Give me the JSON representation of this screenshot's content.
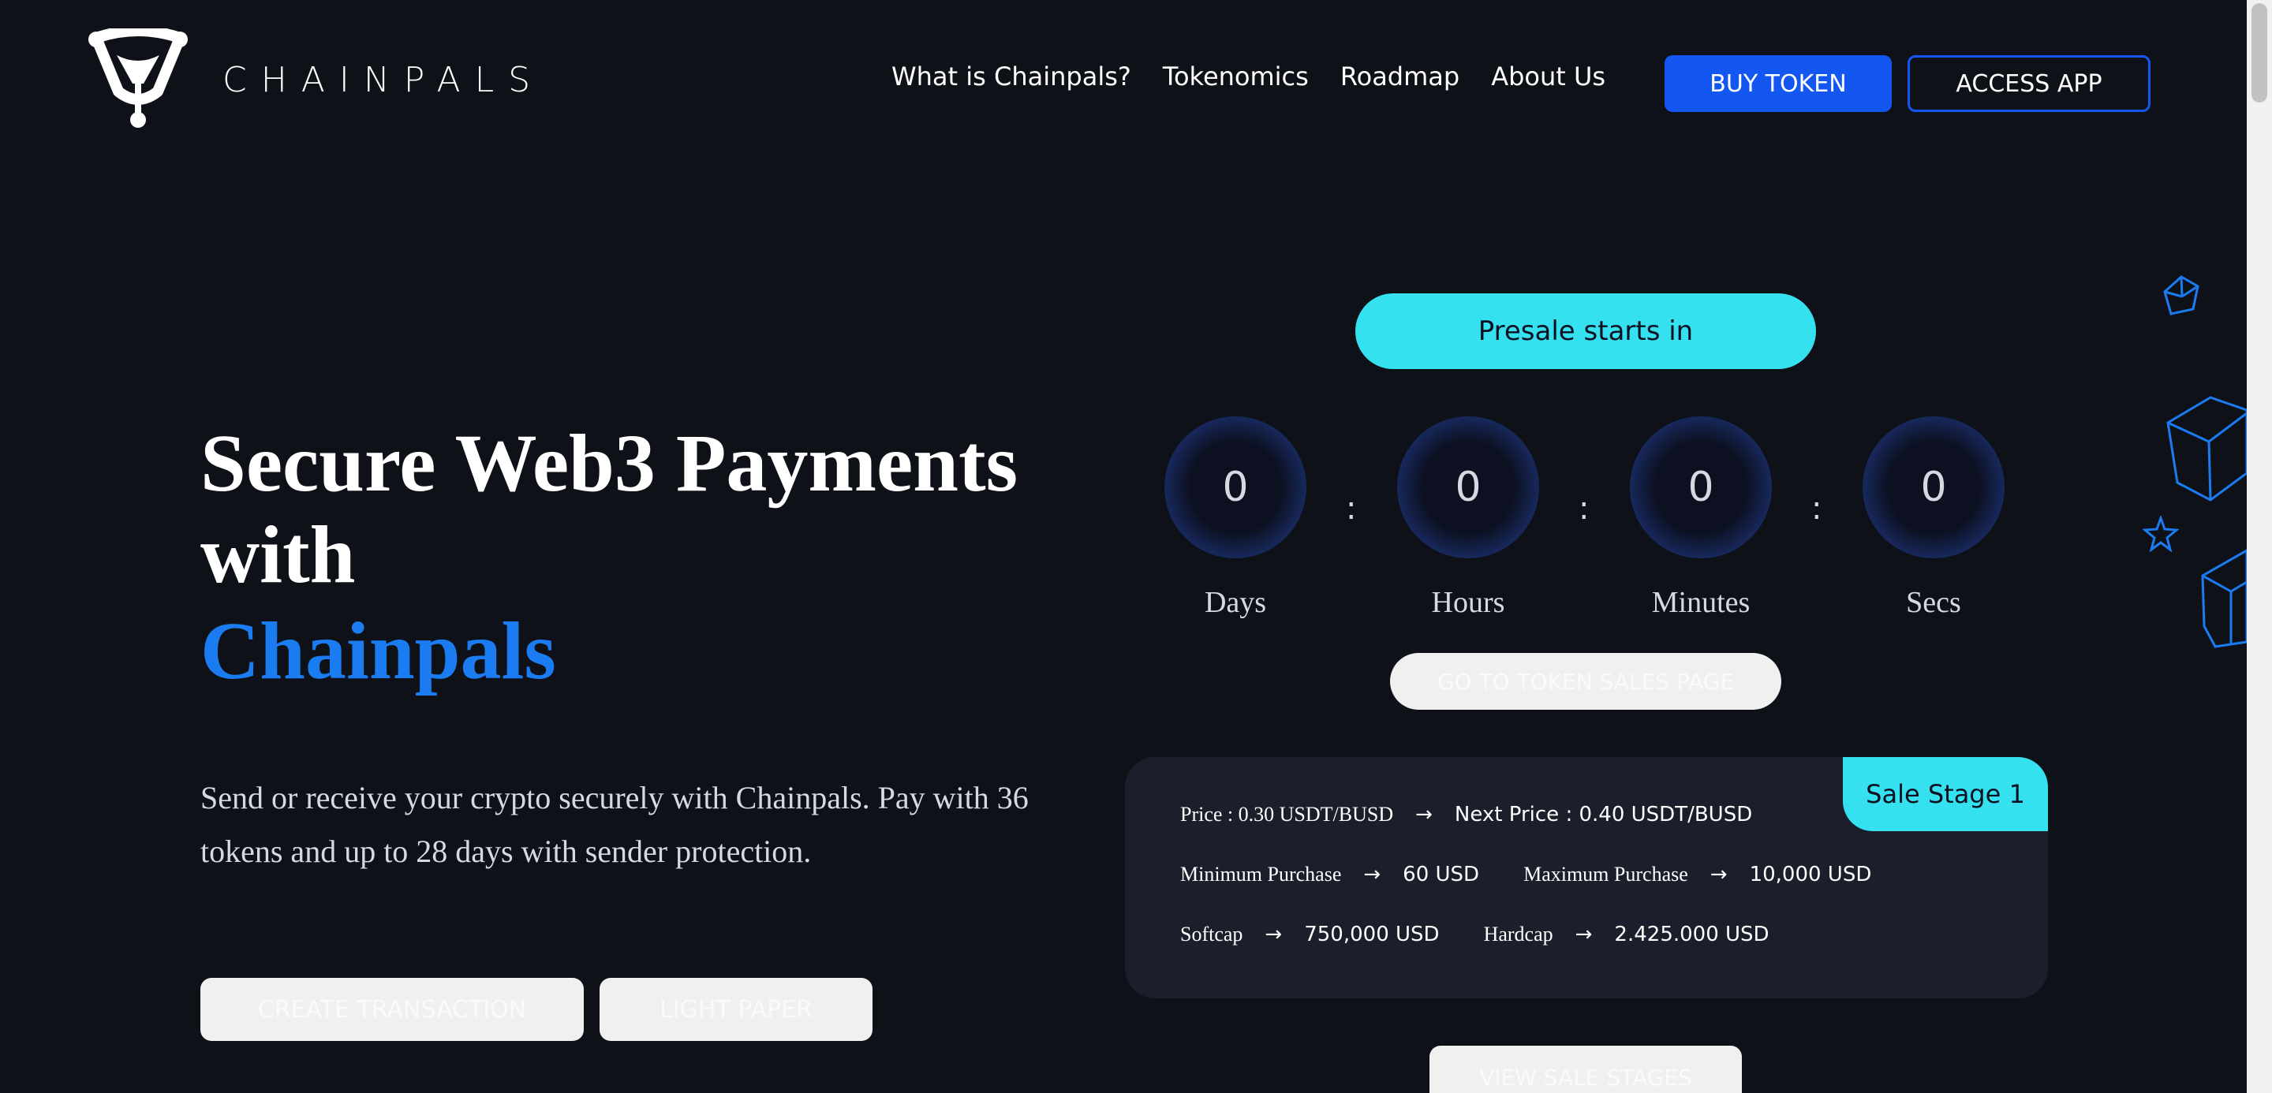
{
  "header": {
    "brand": "CHAINPALS",
    "nav": [
      "What is Chainpals?",
      "Tokenomics",
      "Roadmap",
      "About Us"
    ],
    "buy_label": "BUY TOKEN",
    "access_label": "ACCESS APP"
  },
  "hero": {
    "title": "Secure Web3 Payments with",
    "brand": "Chainpals",
    "description": "Send or receive your crypto securely with Chainpals. Pay with 36 tokens and up to 28 days with sender protection.",
    "create_label": "CREATE TRANSACTION",
    "paper_label": "LIGHT PAPER"
  },
  "presale": {
    "label": "Presale starts in",
    "countdown": [
      {
        "value": "0",
        "unit": "Days"
      },
      {
        "value": "0",
        "unit": "Hours"
      },
      {
        "value": "0",
        "unit": "Minutes"
      },
      {
        "value": "0",
        "unit": "Secs"
      }
    ],
    "separator": ":",
    "go_label": "GO TO TOKEN SALES PAGE",
    "view_label": "VIEW SALE STAGES"
  },
  "sale": {
    "stage": "Sale Stage 1",
    "arrow": "→",
    "price_label": "Price : 0.30 USDT/BUSD",
    "next_price": "Next Price : 0.40 USDT/BUSD",
    "min_label": "Minimum Purchase",
    "min_value": "60 USD",
    "max_label": "Maximum Purchase",
    "max_value": "10,000 USD",
    "softcap_label": "Softcap",
    "softcap_value": "750,000 USD",
    "hardcap_label": "Hardcap",
    "hardcap_value": "2.425.000 USD"
  },
  "colors": {
    "background": "#0f1119",
    "accent_blue": "#1456f0",
    "accent_cyan": "#35e1ee",
    "card": "#1b1e2b"
  }
}
